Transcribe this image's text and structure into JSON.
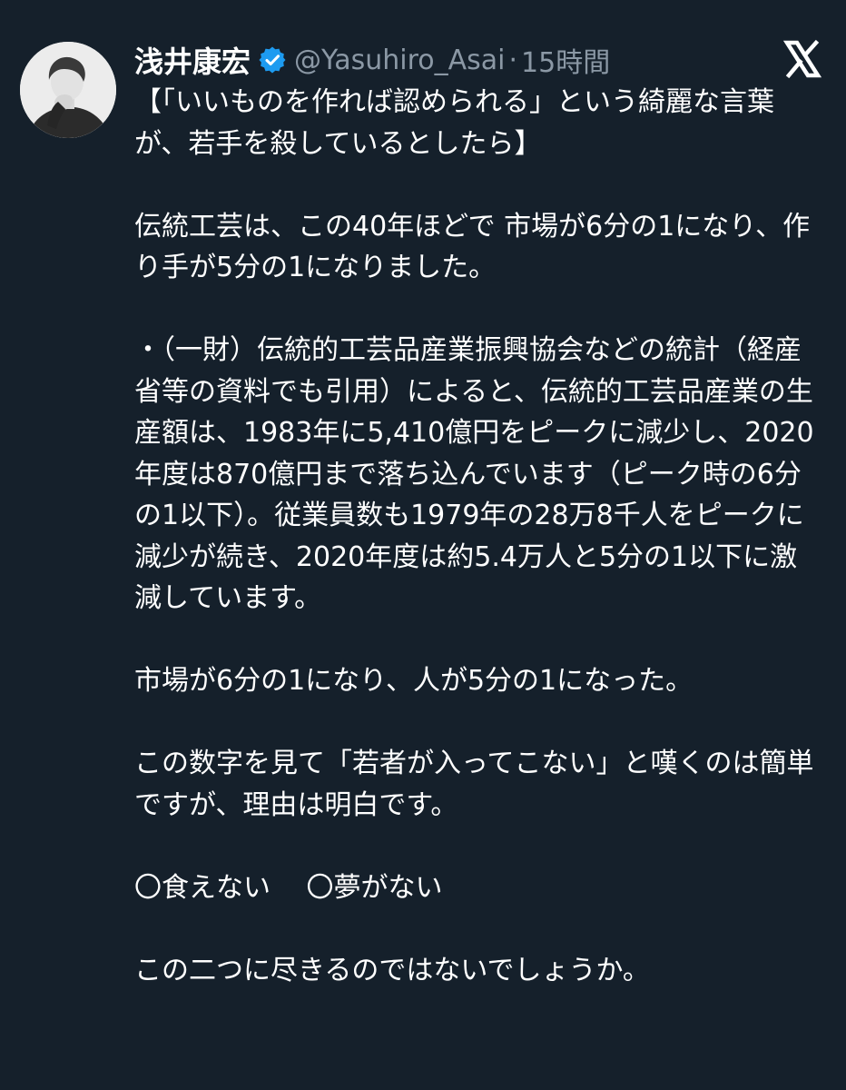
{
  "tweet": {
    "author_name": "浅井康宏",
    "handle": "@Yasuhiro_Asai",
    "separator": "·",
    "timestamp": "15時間",
    "verified_icon": "verified-badge-icon",
    "brand_icon": "x-logo-icon",
    "avatar_icon": "profile-photo",
    "paragraphs": [
      "【「いいものを作れば認められる」という綺麗な言葉が、若手を殺しているとしたら】",
      "伝統工芸は、この40年ほどで 市場が6分の1になり、作り手が5分の1になりました。",
      "・（一財）伝統的工芸品産業振興協会などの統計（経産省等の資料でも引用）によると、伝統的工芸品産業の生産額は、1983年に5,410億円をピークに減少し、2020年度は870億円まで落ち込んでいます（ピーク時の6分の1以下）。従業員数も1979年の28万8千人をピークに減少が続き、2020年度は約5.4万人と5分の1以下に激減しています。",
      "市場が6分の1になり、人が5分の1になった。",
      "この数字を見て「若者が入ってこない」と嘆くのは簡単ですが、理由は明白です。",
      "〇食えない　 〇夢がない",
      "この二つに尽きるのではないでしょうか。"
    ]
  },
  "colors": {
    "background": "#15202b",
    "text": "#ffffff",
    "secondary_text": "#8b98a5",
    "verified_blue": "#1d9bf0"
  }
}
